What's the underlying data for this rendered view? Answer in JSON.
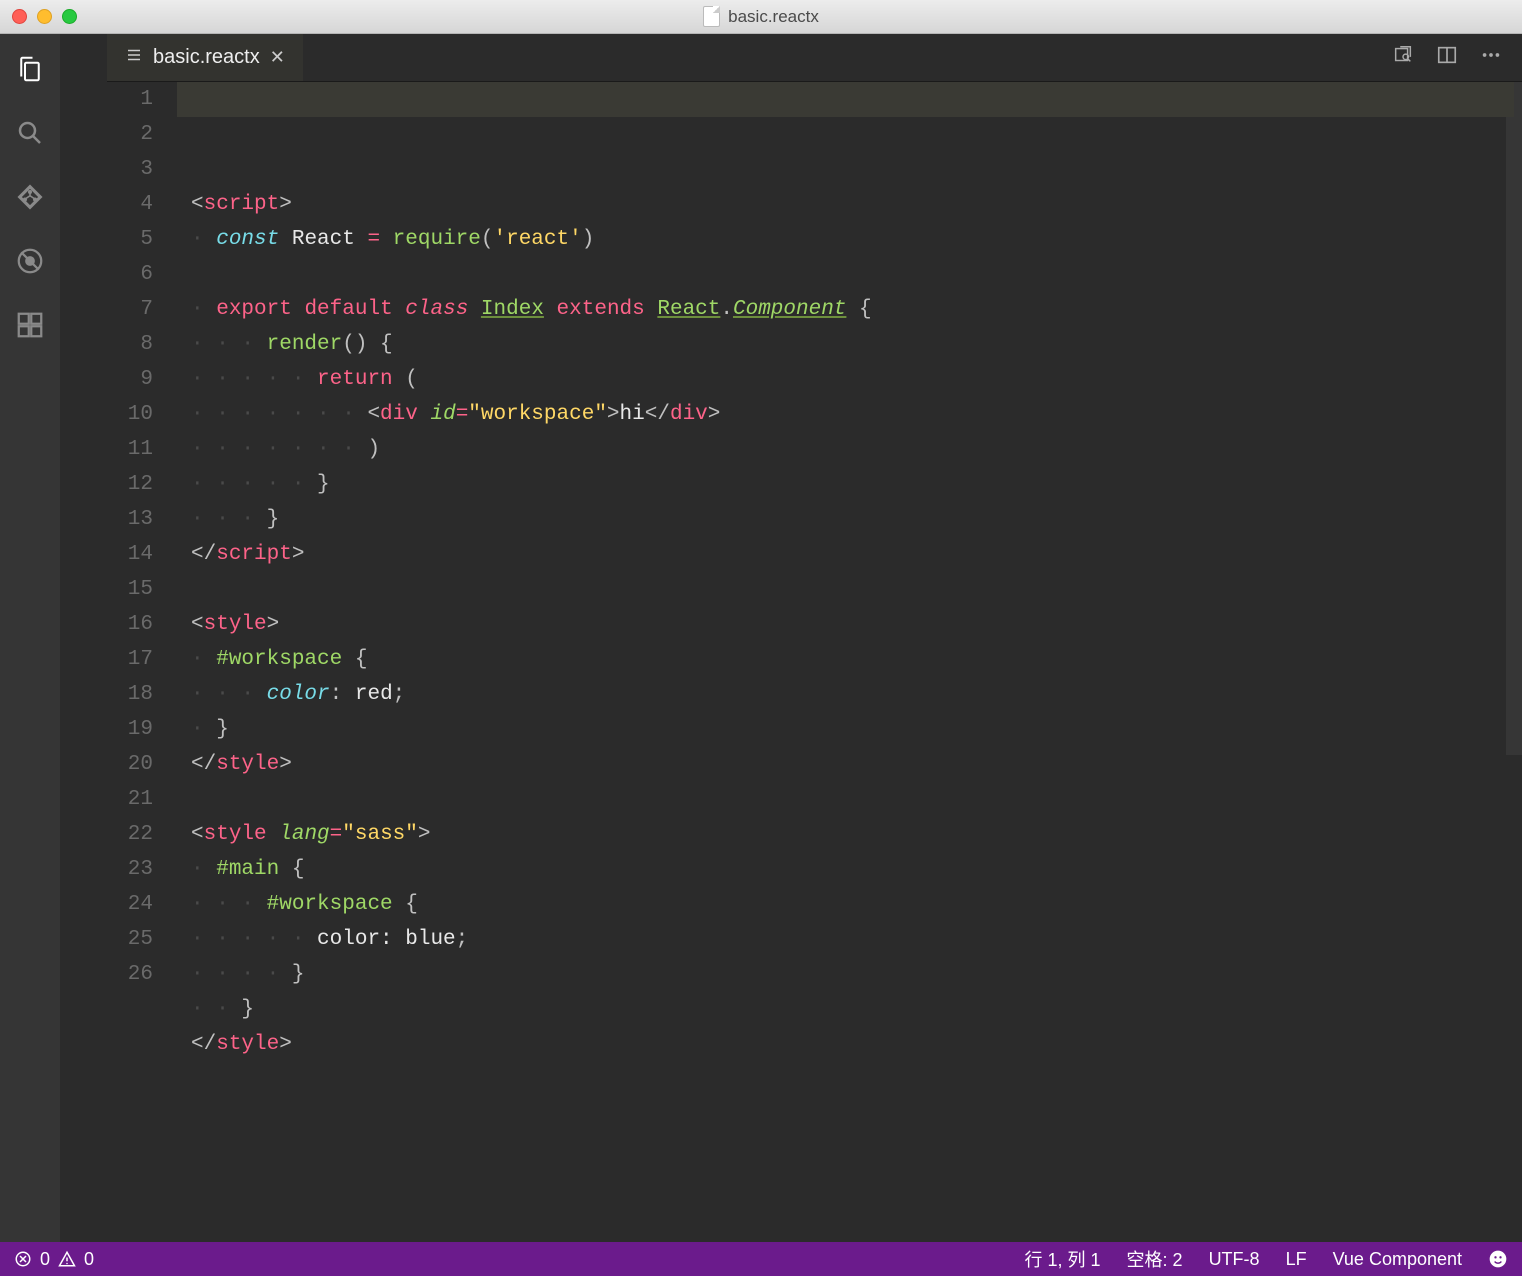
{
  "window": {
    "title": "basic.reactx"
  },
  "tab": {
    "filename": "basic.reactx"
  },
  "gutter": {
    "count": 26
  },
  "code": {
    "lines": [
      [
        {
          "c": "tok-punct",
          "t": "<"
        },
        {
          "c": "tok-tag",
          "t": "script"
        },
        {
          "c": "tok-punct",
          "t": ">"
        }
      ],
      [
        {
          "c": "indent-guide",
          "t": "· "
        },
        {
          "c": "tok-const",
          "t": "const"
        },
        {
          "c": "tok-text",
          "t": " React "
        },
        {
          "c": "tok-op",
          "t": "="
        },
        {
          "c": "tok-text",
          "t": " "
        },
        {
          "c": "tok-fn",
          "t": "require"
        },
        {
          "c": "tok-punct",
          "t": "("
        },
        {
          "c": "tok-str",
          "t": "'react'"
        },
        {
          "c": "tok-punct",
          "t": ")"
        }
      ],
      [
        {
          "c": "tok-text",
          "t": ""
        }
      ],
      [
        {
          "c": "indent-guide",
          "t": "· "
        },
        {
          "c": "tok-kw",
          "t": "export"
        },
        {
          "c": "tok-text",
          "t": " "
        },
        {
          "c": "tok-kw",
          "t": "default"
        },
        {
          "c": "tok-text",
          "t": " "
        },
        {
          "c": "tok-kw-em",
          "t": "class"
        },
        {
          "c": "tok-text",
          "t": " "
        },
        {
          "c": "tok-type",
          "t": "Index"
        },
        {
          "c": "tok-text",
          "t": " "
        },
        {
          "c": "tok-kw",
          "t": "extends"
        },
        {
          "c": "tok-text",
          "t": " "
        },
        {
          "c": "tok-type",
          "t": "React"
        },
        {
          "c": "tok-punct",
          "t": "."
        },
        {
          "c": "tok-type-em",
          "t": "Component"
        },
        {
          "c": "tok-text",
          "t": " "
        },
        {
          "c": "tok-punct",
          "t": "{"
        }
      ],
      [
        {
          "c": "indent-guide",
          "t": "· · · "
        },
        {
          "c": "tok-fn",
          "t": "render"
        },
        {
          "c": "tok-punct",
          "t": "() {"
        }
      ],
      [
        {
          "c": "indent-guide",
          "t": "· · · · · "
        },
        {
          "c": "tok-kw",
          "t": "return"
        },
        {
          "c": "tok-text",
          "t": " "
        },
        {
          "c": "tok-punct",
          "t": "("
        }
      ],
      [
        {
          "c": "indent-guide",
          "t": "· · · · · · · "
        },
        {
          "c": "tok-punct",
          "t": "<"
        },
        {
          "c": "tok-tag",
          "t": "div"
        },
        {
          "c": "tok-text",
          "t": " "
        },
        {
          "c": "tok-attr",
          "t": "id"
        },
        {
          "c": "tok-op",
          "t": "="
        },
        {
          "c": "tok-str",
          "t": "\"workspace\""
        },
        {
          "c": "tok-punct",
          "t": ">"
        },
        {
          "c": "tok-text",
          "t": "hi"
        },
        {
          "c": "tok-punct",
          "t": "</"
        },
        {
          "c": "tok-tag",
          "t": "div"
        },
        {
          "c": "tok-punct",
          "t": ">"
        }
      ],
      [
        {
          "c": "indent-guide",
          "t": "· · · · · · · "
        },
        {
          "c": "tok-punct",
          "t": ")"
        }
      ],
      [
        {
          "c": "indent-guide",
          "t": "· · · · · "
        },
        {
          "c": "tok-punct",
          "t": "}"
        }
      ],
      [
        {
          "c": "indent-guide",
          "t": "· · · "
        },
        {
          "c": "tok-punct",
          "t": "}"
        }
      ],
      [
        {
          "c": "tok-punct",
          "t": "</"
        },
        {
          "c": "tok-tag",
          "t": "script"
        },
        {
          "c": "tok-punct",
          "t": ">"
        }
      ],
      [
        {
          "c": "tok-text",
          "t": ""
        }
      ],
      [
        {
          "c": "tok-punct",
          "t": "<"
        },
        {
          "c": "tok-tag",
          "t": "style"
        },
        {
          "c": "tok-punct",
          "t": ">"
        }
      ],
      [
        {
          "c": "indent-guide",
          "t": "· "
        },
        {
          "c": "tok-selector",
          "t": "#workspace"
        },
        {
          "c": "tok-text",
          "t": " "
        },
        {
          "c": "tok-punct",
          "t": "{"
        }
      ],
      [
        {
          "c": "indent-guide",
          "t": "· · · "
        },
        {
          "c": "tok-prop",
          "t": "color"
        },
        {
          "c": "tok-punct",
          "t": ":"
        },
        {
          "c": "tok-text",
          "t": " "
        },
        {
          "c": "tok-val",
          "t": "red"
        },
        {
          "c": "tok-punct",
          "t": ";"
        }
      ],
      [
        {
          "c": "indent-guide",
          "t": "· "
        },
        {
          "c": "tok-punct",
          "t": "}"
        }
      ],
      [
        {
          "c": "tok-punct",
          "t": "</"
        },
        {
          "c": "tok-tag",
          "t": "style"
        },
        {
          "c": "tok-punct",
          "t": ">"
        }
      ],
      [
        {
          "c": "tok-text",
          "t": ""
        }
      ],
      [
        {
          "c": "tok-punct",
          "t": "<"
        },
        {
          "c": "tok-tag",
          "t": "style"
        },
        {
          "c": "tok-text",
          "t": " "
        },
        {
          "c": "tok-attr",
          "t": "lang"
        },
        {
          "c": "tok-op",
          "t": "="
        },
        {
          "c": "tok-str",
          "t": "\"sass\""
        },
        {
          "c": "tok-punct",
          "t": ">"
        }
      ],
      [
        {
          "c": "indent-guide",
          "t": "· "
        },
        {
          "c": "tok-selector",
          "t": "#main"
        },
        {
          "c": "tok-text",
          "t": " "
        },
        {
          "c": "tok-punct",
          "t": "{"
        }
      ],
      [
        {
          "c": "indent-guide",
          "t": "· · · "
        },
        {
          "c": "tok-selector",
          "t": "#workspace"
        },
        {
          "c": "tok-text",
          "t": " "
        },
        {
          "c": "tok-punct",
          "t": "{"
        }
      ],
      [
        {
          "c": "indent-guide",
          "t": "· · · · · "
        },
        {
          "c": "tok-text",
          "t": "color: blue"
        },
        {
          "c": "tok-punct",
          "t": ";"
        }
      ],
      [
        {
          "c": "indent-guide",
          "t": "· · · · "
        },
        {
          "c": "tok-punct",
          "t": "}"
        }
      ],
      [
        {
          "c": "indent-guide",
          "t": "· · "
        },
        {
          "c": "tok-punct",
          "t": "}"
        }
      ],
      [
        {
          "c": "tok-punct",
          "t": "</"
        },
        {
          "c": "tok-tag",
          "t": "style"
        },
        {
          "c": "tok-punct",
          "t": ">"
        }
      ],
      [
        {
          "c": "tok-text",
          "t": ""
        }
      ]
    ],
    "highlight_line": 1
  },
  "status": {
    "errors": "0",
    "warnings": "0",
    "ln_col": "行 1,  列 1",
    "spaces": "空格: 2",
    "encoding": "UTF-8",
    "eol": "LF",
    "language": "Vue Component"
  }
}
